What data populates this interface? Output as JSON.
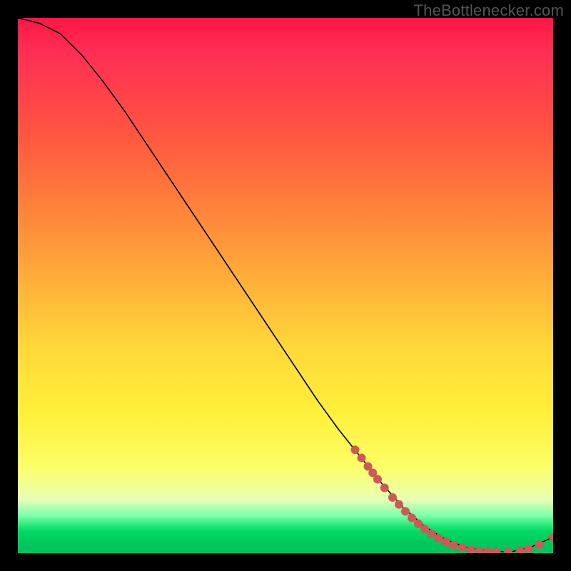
{
  "watermark": "TheBottlenecker.com",
  "colors": {
    "dot": "#cc5a57",
    "curve": "#000000",
    "frame": "#000000"
  },
  "chart_data": {
    "type": "line",
    "title": "",
    "xlabel": "",
    "ylabel": "",
    "xlim": [
      0,
      100
    ],
    "ylim": [
      0,
      100
    ],
    "curve": {
      "x": [
        0,
        4,
        8,
        12,
        16,
        20,
        24,
        28,
        32,
        36,
        40,
        44,
        48,
        52,
        56,
        60,
        64,
        68,
        72,
        76,
        80,
        84,
        88,
        92,
        96,
        100
      ],
      "y": [
        100,
        99,
        97,
        93,
        88,
        82.5,
        76.5,
        70.5,
        64.5,
        58.5,
        52.5,
        46.5,
        40.5,
        34.5,
        28.5,
        23,
        18,
        13,
        8.5,
        5,
        2.5,
        1,
        0.4,
        0.2,
        1.2,
        3
      ]
    },
    "series": [
      {
        "name": "markers",
        "type": "scatter",
        "points": [
          {
            "x": 63,
            "y": 19.3
          },
          {
            "x": 64.2,
            "y": 17.8
          },
          {
            "x": 65.4,
            "y": 16.2
          },
          {
            "x": 66.3,
            "y": 15.0
          },
          {
            "x": 67.2,
            "y": 13.8
          },
          {
            "x": 68.5,
            "y": 12.2
          },
          {
            "x": 70.0,
            "y": 10.4
          },
          {
            "x": 71.2,
            "y": 9.1
          },
          {
            "x": 72.4,
            "y": 7.8
          },
          {
            "x": 73.6,
            "y": 6.6
          },
          {
            "x": 74.8,
            "y": 5.5
          },
          {
            "x": 76.0,
            "y": 4.5
          },
          {
            "x": 77.3,
            "y": 3.6
          },
          {
            "x": 78.6,
            "y": 2.8
          },
          {
            "x": 80.0,
            "y": 2.1
          },
          {
            "x": 81.4,
            "y": 1.5
          },
          {
            "x": 83.0,
            "y": 1.0
          },
          {
            "x": 84.6,
            "y": 0.6
          },
          {
            "x": 86.2,
            "y": 0.4
          },
          {
            "x": 87.8,
            "y": 0.3
          },
          {
            "x": 89.4,
            "y": 0.2
          },
          {
            "x": 91.6,
            "y": 0.2
          },
          {
            "x": 93.8,
            "y": 0.4
          },
          {
            "x": 95.4,
            "y": 0.8
          },
          {
            "x": 97.4,
            "y": 1.6
          },
          {
            "x": 100,
            "y": 3.0
          }
        ]
      }
    ]
  }
}
